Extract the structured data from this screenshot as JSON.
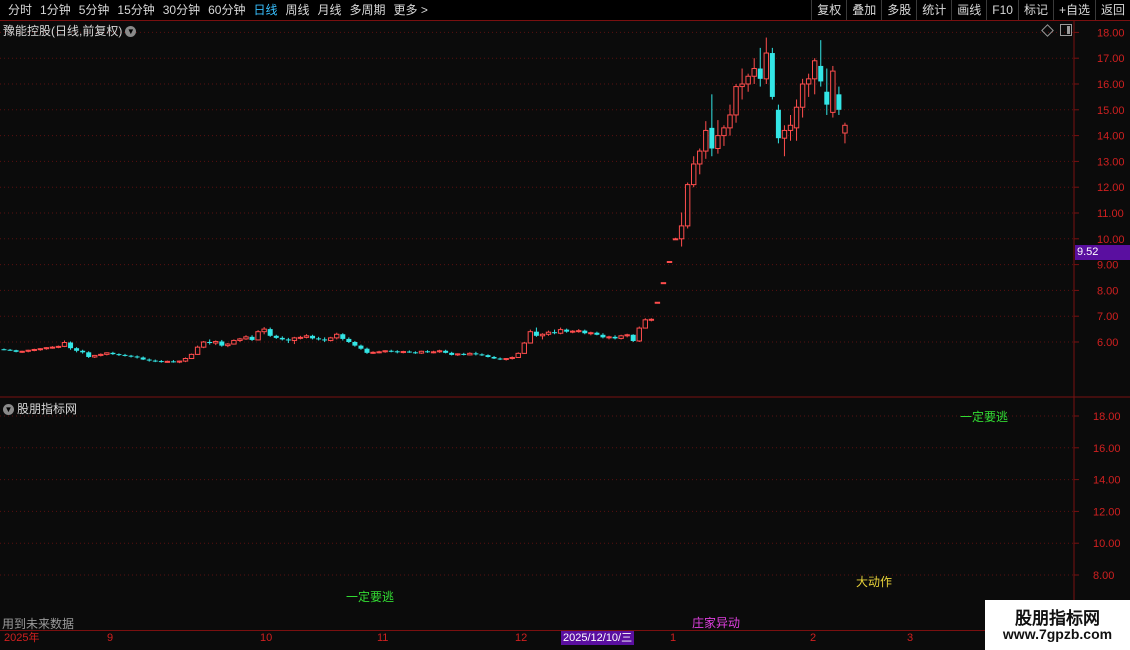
{
  "toolbar": {
    "periods": [
      "分时",
      "1分钟",
      "5分钟",
      "15分钟",
      "30分钟",
      "60分钟",
      "日线",
      "周线",
      "月线",
      "多周期",
      "更多 >"
    ],
    "active_period": "日线",
    "buttons": [
      "复权",
      "叠加",
      "多股",
      "统计",
      "画线",
      "F10",
      "标记",
      "+自选",
      "返回"
    ]
  },
  "main_chart": {
    "title": "豫能控股(日线,前复权)",
    "price_axis_labels": [
      "18.00",
      "17.00",
      "16.00",
      "15.00",
      "14.00",
      "13.00",
      "12.00",
      "11.00",
      "10.00",
      "9.00",
      "8.00",
      "7.00",
      "6.00"
    ],
    "current_price_label": "9.52"
  },
  "sub_chart": {
    "title": "股朋指标网",
    "axis_labels": [
      "18.00",
      "16.00",
      "14.00",
      "12.00",
      "10.00",
      "8.00"
    ],
    "signals": [
      {
        "text": "一定要逃",
        "color": "#33dd33"
      },
      {
        "text": "大动作",
        "color": "#e8d23a"
      },
      {
        "text": "庄家异动",
        "color": "#e040e0"
      },
      {
        "text": "一定要逃",
        "color": "#33dd33"
      }
    ],
    "footnote": "用到未来数据"
  },
  "date_axis": {
    "labels": [
      "2025年",
      "9",
      "10",
      "11",
      "12",
      "1",
      "2",
      "3"
    ],
    "cursor_date": "2025/12/10/三"
  },
  "watermark": {
    "logo_text": "股朋指标网",
    "url": "www.7gpzb.com"
  },
  "colors": {
    "up": "#ff4d4d",
    "down": "#33e6e6",
    "grid": "#5a1010",
    "axis_text": "#d02020",
    "accent": "#5a0fa0"
  },
  "chart_data": {
    "type": "candlestick",
    "period": "daily",
    "price_axis_range": [
      5.0,
      18.3
    ],
    "candles": [
      [
        5.72,
        5.75,
        5.68,
        5.7
      ],
      [
        5.7,
        5.73,
        5.66,
        5.69
      ],
      [
        5.68,
        5.7,
        5.6,
        5.62
      ],
      [
        5.62,
        5.66,
        5.58,
        5.64
      ],
      [
        5.64,
        5.7,
        5.6,
        5.68
      ],
      [
        5.68,
        5.74,
        5.64,
        5.71
      ],
      [
        5.71,
        5.76,
        5.66,
        5.74
      ],
      [
        5.74,
        5.8,
        5.7,
        5.78
      ],
      [
        5.78,
        5.84,
        5.74,
        5.8
      ],
      [
        5.8,
        5.86,
        5.76,
        5.83
      ],
      [
        5.83,
        6.06,
        5.8,
        5.98
      ],
      [
        5.98,
        6.02,
        5.7,
        5.76
      ],
      [
        5.76,
        5.8,
        5.6,
        5.66
      ],
      [
        5.66,
        5.7,
        5.55,
        5.6
      ],
      [
        5.6,
        5.64,
        5.38,
        5.42
      ],
      [
        5.42,
        5.5,
        5.38,
        5.48
      ],
      [
        5.48,
        5.56,
        5.44,
        5.52
      ],
      [
        5.52,
        5.6,
        5.48,
        5.58
      ],
      [
        5.58,
        5.62,
        5.5,
        5.53
      ],
      [
        5.53,
        5.56,
        5.46,
        5.5
      ],
      [
        5.5,
        5.54,
        5.44,
        5.47
      ],
      [
        5.47,
        5.5,
        5.4,
        5.44
      ],
      [
        5.44,
        5.48,
        5.36,
        5.4
      ],
      [
        5.4,
        5.44,
        5.3,
        5.32
      ],
      [
        5.32,
        5.36,
        5.24,
        5.28
      ],
      [
        5.28,
        5.32,
        5.22,
        5.26
      ],
      [
        5.26,
        5.3,
        5.2,
        5.24
      ],
      [
        5.24,
        5.28,
        5.2,
        5.25
      ],
      [
        5.25,
        5.3,
        5.2,
        5.22
      ],
      [
        5.22,
        5.28,
        5.18,
        5.26
      ],
      [
        5.26,
        5.4,
        5.22,
        5.36
      ],
      [
        5.36,
        5.55,
        5.34,
        5.52
      ],
      [
        5.52,
        5.86,
        5.5,
        5.8
      ],
      [
        5.8,
        6.04,
        5.76,
        6.0
      ],
      [
        6.0,
        6.1,
        5.9,
        5.96
      ],
      [
        5.96,
        6.06,
        5.88,
        6.02
      ],
      [
        6.02,
        6.08,
        5.82,
        5.86
      ],
      [
        5.86,
        5.96,
        5.8,
        5.92
      ],
      [
        5.92,
        6.1,
        5.9,
        6.06
      ],
      [
        6.06,
        6.16,
        6.0,
        6.12
      ],
      [
        6.12,
        6.26,
        6.08,
        6.2
      ],
      [
        6.2,
        6.26,
        6.04,
        6.08
      ],
      [
        6.08,
        6.46,
        6.06,
        6.4
      ],
      [
        6.4,
        6.58,
        6.3,
        6.5
      ],
      [
        6.5,
        6.56,
        6.2,
        6.24
      ],
      [
        6.24,
        6.28,
        6.12,
        6.16
      ],
      [
        6.16,
        6.22,
        6.06,
        6.1
      ],
      [
        6.1,
        6.16,
        5.96,
        6.06
      ],
      [
        6.06,
        6.2,
        5.92,
        6.16
      ],
      [
        6.16,
        6.24,
        6.1,
        6.18
      ],
      [
        6.18,
        6.3,
        6.14,
        6.24
      ],
      [
        6.24,
        6.28,
        6.1,
        6.14
      ],
      [
        6.14,
        6.2,
        6.06,
        6.1
      ],
      [
        6.1,
        6.18,
        6.0,
        6.06
      ],
      [
        6.06,
        6.2,
        6.02,
        6.16
      ],
      [
        6.16,
        6.36,
        6.1,
        6.3
      ],
      [
        6.3,
        6.34,
        6.06,
        6.12
      ],
      [
        6.12,
        6.18,
        5.96,
        6.0
      ],
      [
        6.0,
        6.04,
        5.82,
        5.86
      ],
      [
        5.86,
        5.9,
        5.7,
        5.74
      ],
      [
        5.74,
        5.78,
        5.54,
        5.58
      ],
      [
        5.58,
        5.64,
        5.54,
        5.6
      ],
      [
        5.6,
        5.66,
        5.56,
        5.62
      ],
      [
        5.62,
        5.68,
        5.58,
        5.66
      ],
      [
        5.66,
        5.7,
        5.6,
        5.64
      ],
      [
        5.64,
        5.68,
        5.56,
        5.6
      ],
      [
        5.6,
        5.66,
        5.56,
        5.63
      ],
      [
        5.63,
        5.67,
        5.58,
        5.6
      ],
      [
        5.6,
        5.64,
        5.54,
        5.57
      ],
      [
        5.57,
        5.66,
        5.54,
        5.64
      ],
      [
        5.64,
        5.68,
        5.58,
        5.6
      ],
      [
        5.6,
        5.66,
        5.56,
        5.62
      ],
      [
        5.62,
        5.7,
        5.58,
        5.66
      ],
      [
        5.66,
        5.7,
        5.56,
        5.58
      ],
      [
        5.58,
        5.62,
        5.48,
        5.5
      ],
      [
        5.5,
        5.56,
        5.46,
        5.54
      ],
      [
        5.54,
        5.58,
        5.48,
        5.5
      ],
      [
        5.5,
        5.6,
        5.48,
        5.56
      ],
      [
        5.56,
        5.62,
        5.48,
        5.52
      ],
      [
        5.52,
        5.56,
        5.46,
        5.49
      ],
      [
        5.49,
        5.52,
        5.4,
        5.42
      ],
      [
        5.42,
        5.46,
        5.34,
        5.36
      ],
      [
        5.36,
        5.4,
        5.3,
        5.34
      ],
      [
        5.34,
        5.38,
        5.28,
        5.36
      ],
      [
        5.36,
        5.44,
        5.32,
        5.4
      ],
      [
        5.4,
        5.6,
        5.38,
        5.56
      ],
      [
        5.56,
        6.0,
        5.54,
        5.96
      ],
      [
        5.96,
        6.48,
        5.94,
        6.4
      ],
      [
        6.4,
        6.56,
        6.2,
        6.24
      ],
      [
        6.24,
        6.34,
        6.1,
        6.3
      ],
      [
        6.3,
        6.44,
        6.24,
        6.38
      ],
      [
        6.38,
        6.48,
        6.3,
        6.34
      ],
      [
        6.34,
        6.56,
        6.3,
        6.48
      ],
      [
        6.48,
        6.52,
        6.36,
        6.4
      ],
      [
        6.4,
        6.46,
        6.34,
        6.42
      ],
      [
        6.42,
        6.5,
        6.36,
        6.44
      ],
      [
        6.44,
        6.48,
        6.3,
        6.34
      ],
      [
        6.34,
        6.4,
        6.26,
        6.36
      ],
      [
        6.36,
        6.4,
        6.26,
        6.28
      ],
      [
        6.28,
        6.34,
        6.14,
        6.18
      ],
      [
        6.18,
        6.24,
        6.1,
        6.2
      ],
      [
        6.2,
        6.26,
        6.1,
        6.14
      ],
      [
        6.14,
        6.28,
        6.1,
        6.24
      ],
      [
        6.24,
        6.32,
        6.18,
        6.28
      ],
      [
        6.28,
        6.3,
        6.0,
        6.04
      ],
      [
        6.04,
        6.6,
        6.0,
        6.54
      ],
      [
        6.54,
        6.92,
        6.52,
        6.86
      ],
      [
        6.86,
        6.92,
        6.8,
        6.88
      ],
      [
        7.54,
        7.54,
        7.54,
        7.54
      ],
      [
        8.3,
        8.3,
        8.3,
        8.3
      ],
      [
        9.12,
        9.12,
        9.12,
        9.12
      ],
      [
        10.0,
        10.04,
        9.96,
        10.0
      ],
      [
        10.0,
        11.02,
        9.7,
        10.5
      ],
      [
        10.5,
        12.18,
        10.4,
        12.1
      ],
      [
        12.1,
        13.2,
        12.0,
        12.9
      ],
      [
        12.9,
        13.5,
        12.5,
        13.4
      ],
      [
        13.4,
        14.56,
        13.1,
        14.2
      ],
      [
        14.3,
        15.6,
        13.2,
        13.5
      ],
      [
        13.5,
        14.6,
        13.3,
        14.0
      ],
      [
        14.0,
        14.4,
        13.6,
        14.3
      ],
      [
        14.3,
        15.2,
        14.0,
        14.8
      ],
      [
        14.8,
        16.0,
        14.5,
        15.9
      ],
      [
        15.9,
        16.6,
        15.4,
        16.0
      ],
      [
        16.0,
        16.4,
        15.7,
        16.3
      ],
      [
        16.3,
        17.0,
        16.0,
        16.6
      ],
      [
        16.6,
        17.4,
        15.9,
        16.2
      ],
      [
        16.2,
        17.8,
        16.0,
        17.2
      ],
      [
        17.2,
        17.4,
        15.4,
        15.5
      ],
      [
        15.0,
        15.2,
        13.7,
        13.9
      ],
      [
        13.9,
        14.4,
        13.2,
        14.2
      ],
      [
        14.2,
        14.8,
        13.8,
        14.4
      ],
      [
        14.3,
        15.4,
        13.8,
        15.1
      ],
      [
        15.1,
        16.2,
        14.7,
        16.0
      ],
      [
        16.0,
        16.4,
        15.5,
        16.2
      ],
      [
        16.2,
        17.0,
        15.6,
        16.9
      ],
      [
        16.7,
        17.7,
        15.9,
        16.1
      ],
      [
        15.7,
        16.6,
        14.8,
        15.2
      ],
      [
        14.9,
        16.7,
        14.7,
        16.5
      ],
      [
        15.6,
        15.9,
        14.8,
        15.0
      ],
      [
        14.1,
        14.5,
        13.7,
        14.4
      ]
    ]
  }
}
